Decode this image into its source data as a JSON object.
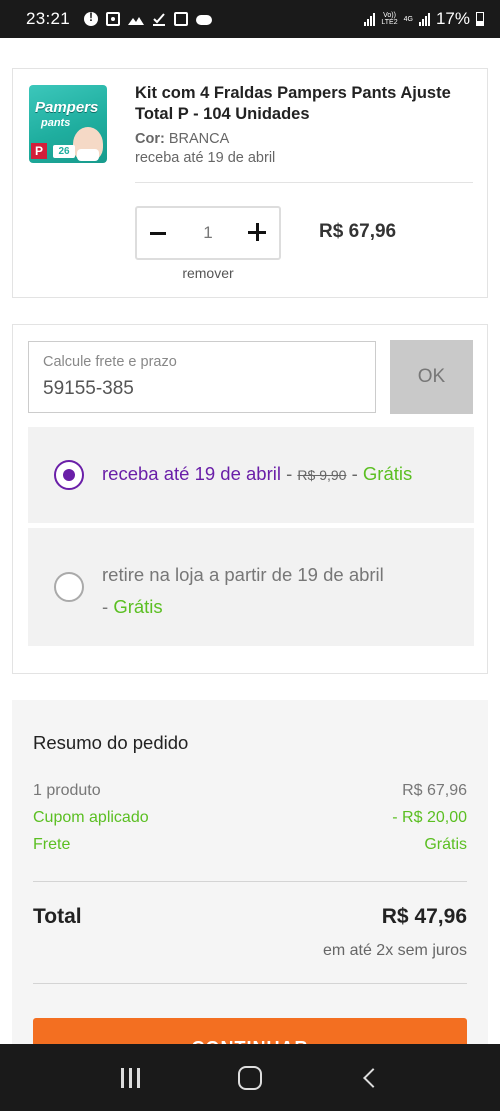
{
  "status_bar": {
    "time": "23:21",
    "battery": "17%",
    "network_top": "Vo))",
    "network_bottom": "LTE2",
    "network_type": "4G"
  },
  "cart_item": {
    "image_brand": "Pampers",
    "image_sub": "pants",
    "image_size": "P",
    "image_count": "26",
    "title": "Kit com 4 Fraldas Pampers Pants Ajuste Total P - 104 Unidades",
    "color_label": "Cor:",
    "color_value": "BRANCA",
    "delivery": "receba até 19 de abril",
    "quantity": "1",
    "remove_label": "remover",
    "price": "R$ 67,96"
  },
  "shipping": {
    "cep_label": "Calcule frete e prazo",
    "cep_value": "59155-385",
    "ok_label": "OK",
    "options": [
      {
        "text": "receba até 19 de abril",
        "separator": " - ",
        "old_price": "R$ 9,90",
        "separator2": " - ",
        "price": "Grátis",
        "selected": true
      },
      {
        "text": "retire na loja a partir de 19 de abril",
        "separator": "- ",
        "price": "Grátis",
        "selected": false
      }
    ]
  },
  "summary": {
    "title": "Resumo do pedido",
    "rows": [
      {
        "label": "1 produto",
        "value": "R$ 67,96"
      },
      {
        "label": "Cupom aplicado",
        "value": "- R$ 20,00"
      },
      {
        "label": "Frete",
        "value": "Grátis"
      }
    ],
    "total_label": "Total",
    "total_value": "R$ 47,96",
    "installments": "em até 2x sem juros",
    "continue_label": "CONTINUAR"
  },
  "colors": {
    "accent_purple": "#6a1fa8",
    "accent_green": "#5bbf22",
    "continue_orange": "#f36f21"
  },
  "icons": [
    "alert-icon",
    "screen-icon",
    "mountain-icon",
    "download-icon",
    "image-icon",
    "cloud-icon",
    "signal-icon",
    "battery-icon",
    "minus-icon",
    "plus-icon",
    "radio-icon",
    "recents-icon",
    "home-icon",
    "back-icon"
  ]
}
